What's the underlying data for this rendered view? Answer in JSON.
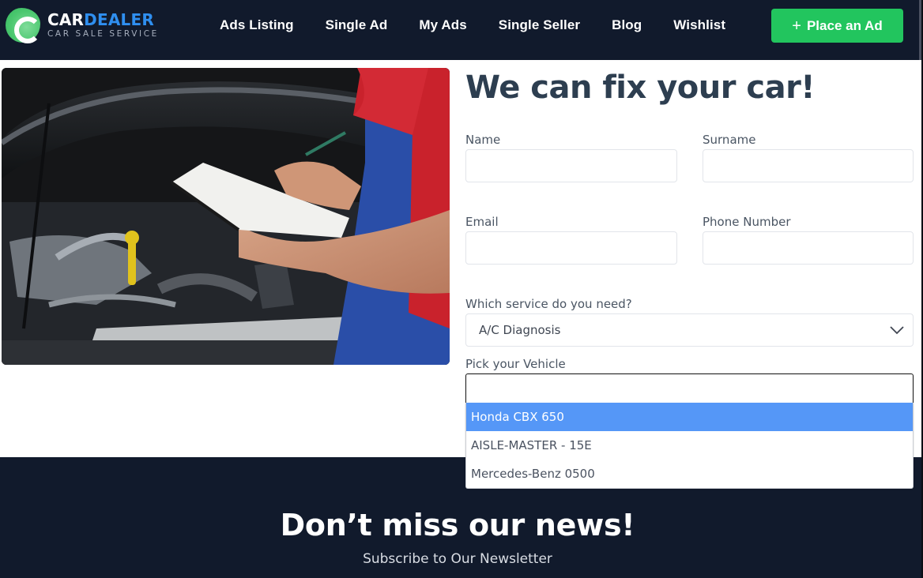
{
  "header": {
    "logo": {
      "title_part1": "CAR",
      "title_part2": "DEALER",
      "subtitle": "CAR SALE SERVICE",
      "icon": "car-dealer-c-logo"
    },
    "nav": [
      {
        "label": "Ads Listing"
      },
      {
        "label": "Single Ad"
      },
      {
        "label": "My Ads"
      },
      {
        "label": "Single Seller"
      },
      {
        "label": "Blog"
      },
      {
        "label": "Wishlist"
      }
    ],
    "cta": {
      "icon": "plus-icon",
      "icon_glyph": "+",
      "label": "Place an Ad"
    },
    "colors": {
      "bg": "#111a2c",
      "accent_blue": "#2f8ff0",
      "cta_green": "#22c55e"
    }
  },
  "hero": {
    "image_description": "mechanic with clipboard inspecting car engine"
  },
  "form": {
    "title": "We can fix your car!",
    "fields": {
      "name": {
        "label": "Name",
        "value": ""
      },
      "surname": {
        "label": "Surname",
        "value": ""
      },
      "email": {
        "label": "Email",
        "value": ""
      },
      "phone": {
        "label": "Phone Number",
        "value": ""
      }
    },
    "service": {
      "label": "Which service do you need?",
      "selected": "A/C Diagnosis",
      "icon": "chevron-down-icon"
    },
    "vehicle": {
      "label": "Pick your Vehicle",
      "value": "",
      "options": [
        {
          "label": "Honda CBX 650",
          "highlighted": true
        },
        {
          "label": "AISLE-MASTER - 15E",
          "highlighted": false
        },
        {
          "label": "Mercedes-Benz 0500",
          "highlighted": false
        }
      ],
      "highlight_color": "#5597f7"
    }
  },
  "newsletter": {
    "title": "Don’t miss our news!",
    "subtitle": "Subscribe to Our Newsletter"
  }
}
